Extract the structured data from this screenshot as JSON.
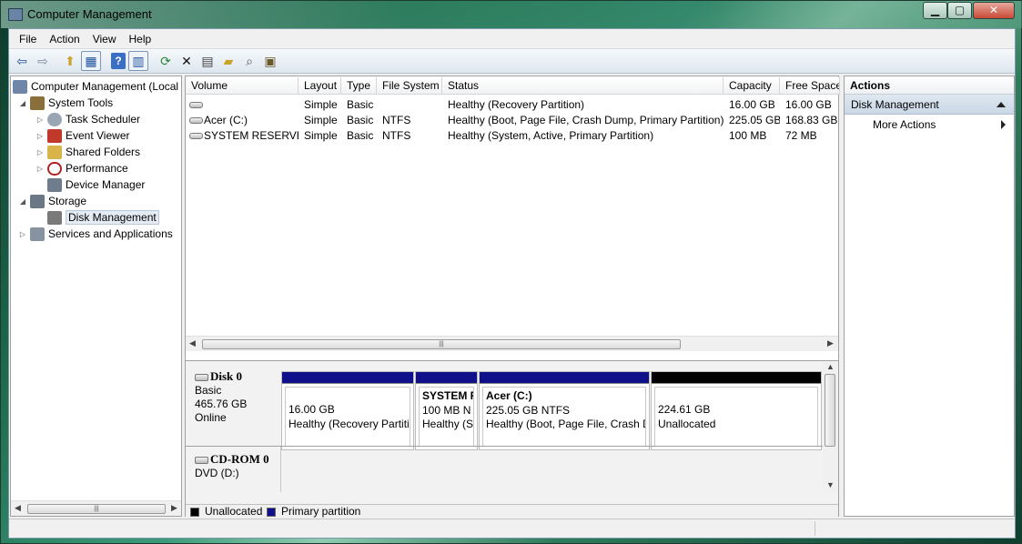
{
  "window": {
    "title": "Computer Management"
  },
  "menu": [
    "File",
    "Action",
    "View",
    "Help"
  ],
  "toolbar": {
    "buttons": [
      {
        "name": "back-icon",
        "glyph": "⇦"
      },
      {
        "name": "forward-icon",
        "glyph": "⇨"
      },
      {
        "name": "up-folder-icon",
        "glyph": "⬆"
      },
      {
        "name": "show-hide-tree-icon",
        "glyph": "▦"
      },
      {
        "name": "help-icon",
        "glyph": "?"
      },
      {
        "name": "show-hide-action-pane-icon",
        "glyph": "▥"
      },
      {
        "name": "refresh-icon",
        "glyph": "⟳"
      },
      {
        "name": "delete-icon",
        "glyph": "✕"
      },
      {
        "name": "properties-icon",
        "glyph": "▤"
      },
      {
        "name": "open-icon",
        "glyph": "📂"
      },
      {
        "name": "search-icon",
        "glyph": "⌕"
      },
      {
        "name": "settings-icon",
        "glyph": "▣"
      }
    ]
  },
  "tree": {
    "root": "Computer Management (Local",
    "items": [
      {
        "label": "System Tools",
        "level": 1,
        "arrow": "◢",
        "icon_color": "#8a6f3a"
      },
      {
        "label": "Task Scheduler",
        "level": 2,
        "arrow": "▷",
        "icon_color": "#9aa6b4"
      },
      {
        "label": "Event Viewer",
        "level": 2,
        "arrow": "▷",
        "icon_color": "#c0392b"
      },
      {
        "label": "Shared Folders",
        "level": 2,
        "arrow": "▷",
        "icon_color": "#d9b44a"
      },
      {
        "label": "Performance",
        "level": 2,
        "arrow": "▷",
        "icon_color": "#b22222"
      },
      {
        "label": "Device Manager",
        "level": 2,
        "arrow": "",
        "icon_color": "#6e7c8c"
      },
      {
        "label": "Storage",
        "level": 1,
        "arrow": "◢",
        "icon_color": "#6b7785"
      },
      {
        "label": "Disk Management",
        "level": 2,
        "arrow": "",
        "icon_color": "#7a7a7a",
        "selected": true
      },
      {
        "label": "Services and Applications",
        "level": 1,
        "arrow": "▷",
        "icon_color": "#8793a1"
      }
    ]
  },
  "volumes": {
    "columns": [
      "Volume",
      "Layout",
      "Type",
      "File System",
      "Status",
      "Capacity",
      "Free Space"
    ],
    "rows": [
      [
        "",
        "Simple",
        "Basic",
        "",
        "Healthy (Recovery Partition)",
        "16.00 GB",
        "16.00 GB"
      ],
      [
        "Acer (C:)",
        "Simple",
        "Basic",
        "NTFS",
        "Healthy (Boot, Page File, Crash Dump, Primary Partition)",
        "225.05 GB",
        "168.83 GB"
      ],
      [
        "SYSTEM RESERVED",
        "Simple",
        "Basic",
        "NTFS",
        "Healthy (System, Active, Primary Partition)",
        "100 MB",
        "72 MB"
      ]
    ]
  },
  "disks": {
    "disk0": {
      "name": "Disk 0",
      "type": "Basic",
      "size": "465.76 GB",
      "state": "Online",
      "partitions": [
        {
          "title": "",
          "line1": "16.00 GB",
          "line2": "Healthy (Recovery Partiti",
          "bar": "primary"
        },
        {
          "title": "SYSTEM R",
          "line1": "100 MB N",
          "line2": "Healthy (S",
          "bar": "primary"
        },
        {
          "title": "Acer  (C:)",
          "line1": "225.05 GB NTFS",
          "line2": "Healthy (Boot, Page File, Crash D",
          "bar": "primary"
        },
        {
          "title": "",
          "line1": "224.61 GB",
          "line2": "Unallocated",
          "bar": "unallocated"
        }
      ]
    },
    "cdrom0": {
      "name": "CD-ROM 0",
      "drive": "DVD (D:)"
    }
  },
  "legend": {
    "unallocated": "Unallocated",
    "primary": "Primary partition",
    "unallocated_color": "#000000",
    "primary_color": "#10108a"
  },
  "actions": {
    "header": "Actions",
    "section": "Disk Management",
    "items": [
      "More Actions"
    ]
  }
}
